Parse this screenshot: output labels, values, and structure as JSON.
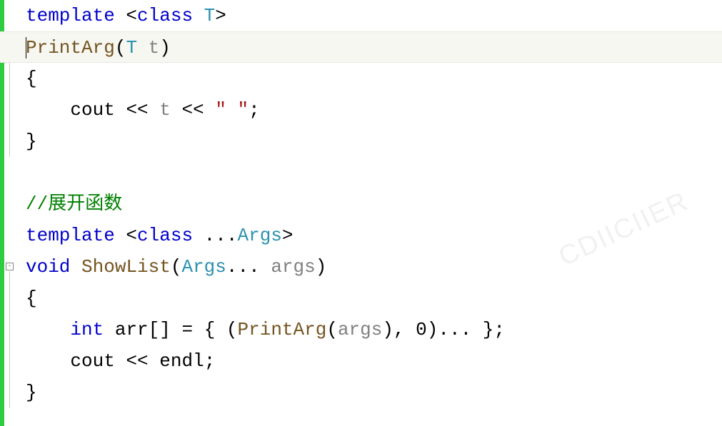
{
  "lines": {
    "l1": {
      "kw1": "template",
      "op1": " <",
      "kw2": "class",
      "sp": " ",
      "type": "T",
      "op2": ">"
    },
    "l2": {
      "fn": "PrintArg",
      "op1": "(",
      "type": "T",
      "sp": " ",
      "param": "t",
      "op2": ")"
    },
    "l3": {
      "txt": "{"
    },
    "l4": {
      "indent": "    ",
      "id1": "cout",
      "sp1": " ",
      "op1": "<<",
      "sp2": " ",
      "param": "t",
      "sp3": " ",
      "op2": "<<",
      "sp4": " ",
      "str": "\" \"",
      "semi": ";"
    },
    "l5": {
      "txt": "}"
    },
    "l6": {
      "txt": ""
    },
    "l7": {
      "comment": "//展开函数"
    },
    "l8": {
      "kw1": "template",
      "op1": " <",
      "kw2": "class",
      "sp": " ",
      "dots": "...",
      "type": "Args",
      "op2": ">"
    },
    "l9": {
      "kw": "void",
      "sp1": " ",
      "fn": "ShowList",
      "op1": "(",
      "type": "Args",
      "dots": "...",
      "sp2": " ",
      "param": "args",
      "op2": ")"
    },
    "l10": {
      "txt": "{"
    },
    "l11": {
      "indent": "    ",
      "kw": "int",
      "sp1": " ",
      "id": "arr",
      "brk": "[]",
      "sp2": " ",
      "eq": "=",
      "sp3": " ",
      "op1": "{ (",
      "fn": "PrintArg",
      "op2": "(",
      "param": "args",
      "op3": "), 0)... };"
    },
    "l12": {
      "indent": "    ",
      "id1": "cout",
      "sp1": " ",
      "op1": "<<",
      "sp2": " ",
      "id2": "endl",
      "semi": ";"
    },
    "l13": {
      "txt": "}"
    }
  },
  "watermark": "CDIICIIER"
}
